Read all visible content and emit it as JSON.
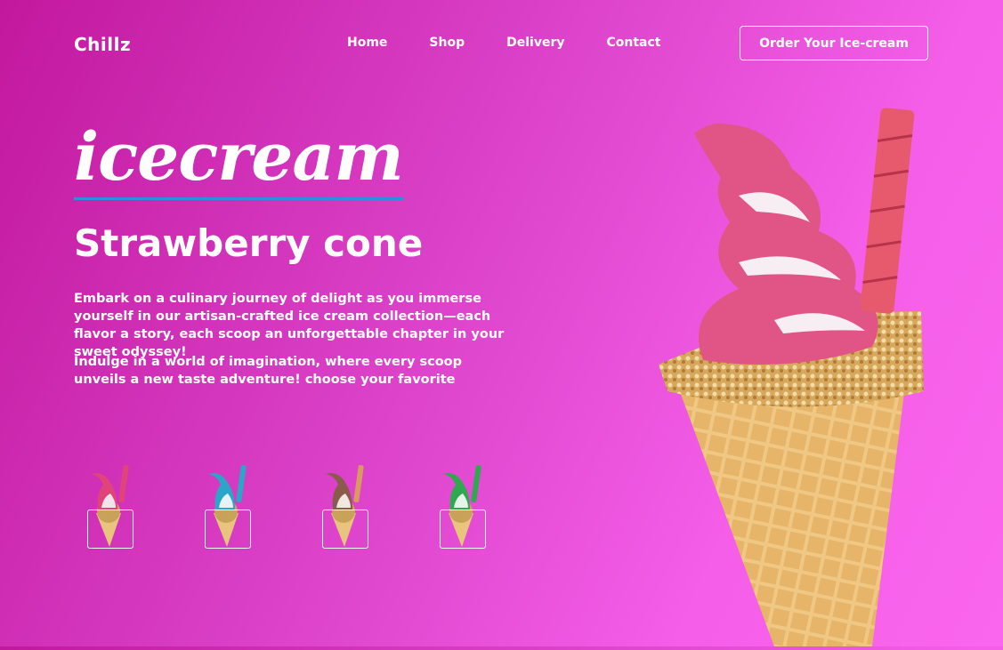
{
  "brand": {
    "name": "Chillz"
  },
  "nav": {
    "items": [
      "Home",
      "Shop",
      "Delivery",
      "Contact"
    ]
  },
  "cta": {
    "label": "Order Your Ice-cream"
  },
  "hero": {
    "script_title": "icecream",
    "title": "Strawberry cone",
    "paragraph1": "Embark on a culinary journey of delight as you immerse yourself in our artisan-crafted ice cream collection—each flavor a story, each scoop an unforgettable chapter in your sweet odyssey!",
    "paragraph2": "Indulge in a world of imagination, where every scoop unveils a new taste adventure! choose your favorite"
  },
  "flavors": [
    {
      "icon": "strawberry-cone-icon",
      "color": "#e0457a"
    },
    {
      "icon": "blue-cone-icon",
      "color": "#2ba6c9"
    },
    {
      "icon": "chocolate-cone-icon",
      "color": "#8a5a4a"
    },
    {
      "icon": "mint-cone-icon",
      "color": "#2fa84f"
    }
  ],
  "colors": {
    "accent_underline": "#2d8ee8",
    "bg_start": "#c2189e",
    "bg_end": "#fb66ee"
  }
}
